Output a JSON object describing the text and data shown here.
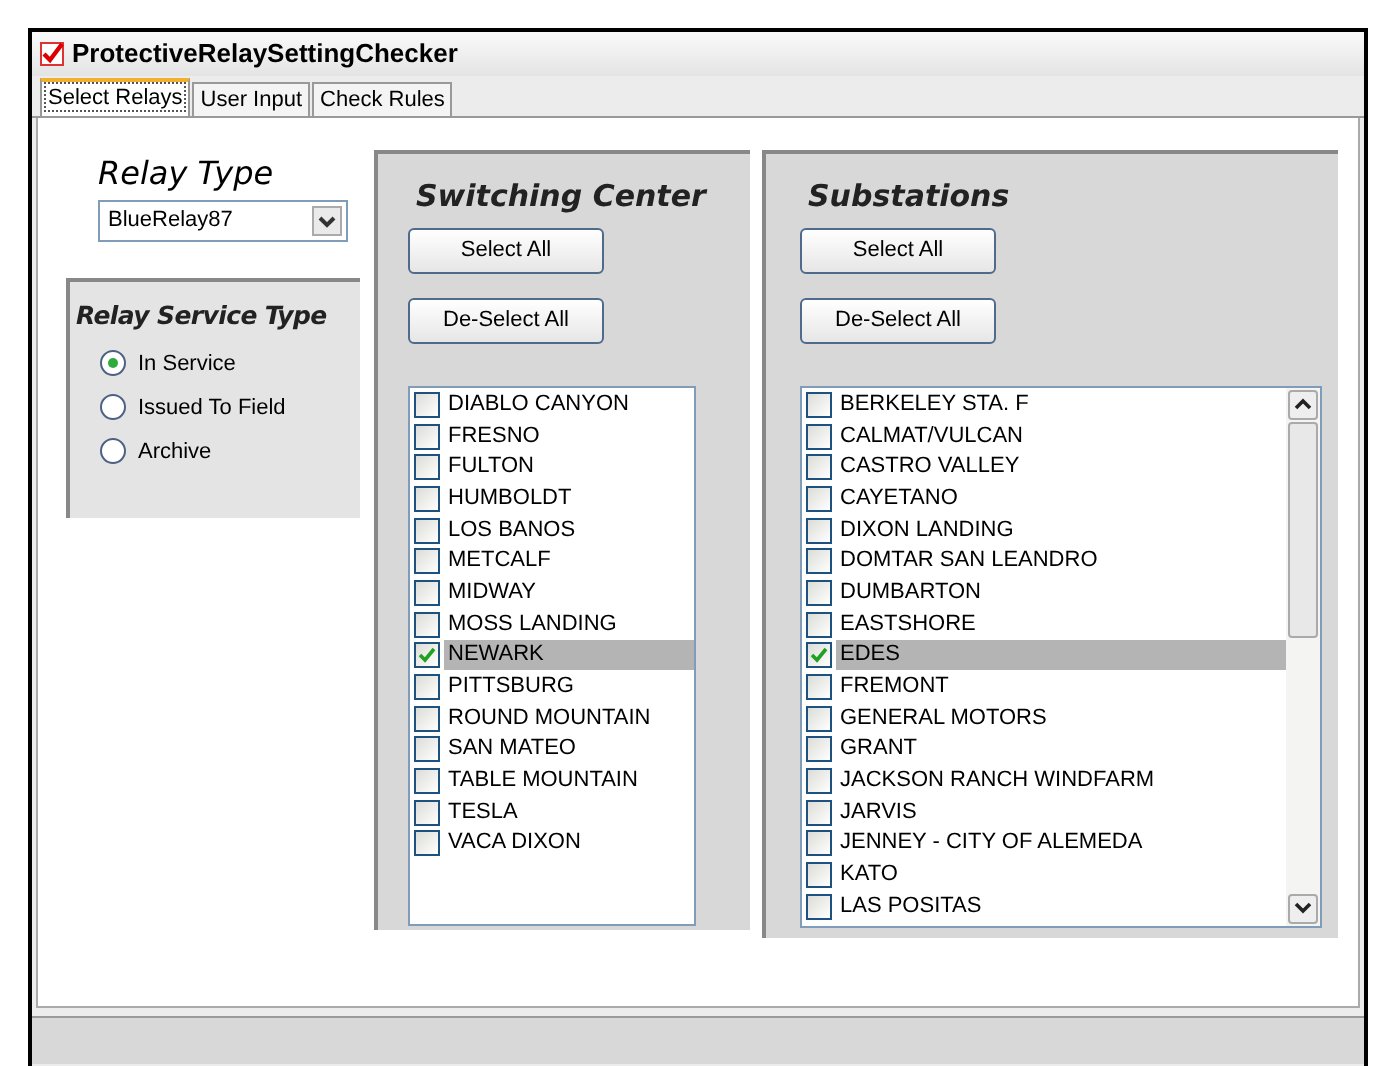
{
  "window": {
    "title": "ProtectiveRelaySettingChecker"
  },
  "tabs": [
    {
      "label": "Select Relays",
      "selected": true
    },
    {
      "label": "User Input",
      "selected": false
    },
    {
      "label": "Check Rules",
      "selected": false
    }
  ],
  "relay_type": {
    "label": "Relay Type",
    "value": "BlueRelay87"
  },
  "service_type": {
    "title": "Relay Service Type",
    "options": [
      {
        "label": "In Service",
        "selected": true
      },
      {
        "label": "Issued To Field",
        "selected": false
      },
      {
        "label": "Archive",
        "selected": false
      }
    ]
  },
  "panels": [
    {
      "title": "Switching Center",
      "buttons": [
        "Select All",
        "De-Select All"
      ],
      "scrollbar": false,
      "items": [
        {
          "label": "DIABLO CANYON",
          "checked": false,
          "selected": false
        },
        {
          "label": "FRESNO",
          "checked": false,
          "selected": false
        },
        {
          "label": "FULTON",
          "checked": false,
          "selected": false
        },
        {
          "label": "HUMBOLDT",
          "checked": false,
          "selected": false
        },
        {
          "label": "LOS BANOS",
          "checked": false,
          "selected": false
        },
        {
          "label": "METCALF",
          "checked": false,
          "selected": false
        },
        {
          "label": "MIDWAY",
          "checked": false,
          "selected": false
        },
        {
          "label": "MOSS LANDING",
          "checked": false,
          "selected": false
        },
        {
          "label": "NEWARK",
          "checked": true,
          "selected": true
        },
        {
          "label": "PITTSBURG",
          "checked": false,
          "selected": false
        },
        {
          "label": "ROUND MOUNTAIN",
          "checked": false,
          "selected": false
        },
        {
          "label": "SAN MATEO",
          "checked": false,
          "selected": false
        },
        {
          "label": "TABLE MOUNTAIN",
          "checked": false,
          "selected": false
        },
        {
          "label": "TESLA",
          "checked": false,
          "selected": false
        },
        {
          "label": "VACA DIXON",
          "checked": false,
          "selected": false
        }
      ]
    },
    {
      "title": "Substations",
      "buttons": [
        "Select All",
        "De-Select All"
      ],
      "scrollbar": true,
      "items": [
        {
          "label": "BERKELEY STA. F",
          "checked": false,
          "selected": false
        },
        {
          "label": "CALMAT/VULCAN",
          "checked": false,
          "selected": false
        },
        {
          "label": "CASTRO VALLEY",
          "checked": false,
          "selected": false
        },
        {
          "label": "CAYETANO",
          "checked": false,
          "selected": false
        },
        {
          "label": "DIXON LANDING",
          "checked": false,
          "selected": false
        },
        {
          "label": "DOMTAR SAN LEANDRO",
          "checked": false,
          "selected": false
        },
        {
          "label": "DUMBARTON",
          "checked": false,
          "selected": false
        },
        {
          "label": "EASTSHORE",
          "checked": false,
          "selected": false
        },
        {
          "label": "EDES",
          "checked": true,
          "selected": true
        },
        {
          "label": "FREMONT",
          "checked": false,
          "selected": false
        },
        {
          "label": "GENERAL MOTORS",
          "checked": false,
          "selected": false
        },
        {
          "label": "GRANT",
          "checked": false,
          "selected": false
        },
        {
          "label": "JACKSON RANCH WINDFARM",
          "checked": false,
          "selected": false
        },
        {
          "label": "JARVIS",
          "checked": false,
          "selected": false
        },
        {
          "label": "JENNEY - CITY OF ALEMEDA",
          "checked": false,
          "selected": false
        },
        {
          "label": "KATO",
          "checked": false,
          "selected": false
        },
        {
          "label": "LAS POSITAS",
          "checked": false,
          "selected": false
        }
      ]
    }
  ]
}
